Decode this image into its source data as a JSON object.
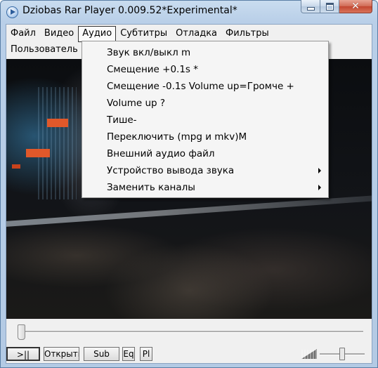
{
  "window": {
    "title": "Dziobas Rar Player 0.009.52*Experimental*",
    "controls": {
      "minimize": "minimize-icon",
      "maximize": "maximize-icon",
      "close": "✕"
    }
  },
  "menubar": {
    "items": [
      "Файл",
      "Видео",
      "Аудио",
      "Субтитры",
      "Отладка",
      "Фильтры"
    ],
    "active": "Аудио",
    "row2": [
      "Пользователь"
    ]
  },
  "audio_menu": {
    "items": [
      {
        "label": "Звук вкл/выкл m",
        "submenu": false
      },
      {
        "label": "Смещение +0.1s *",
        "submenu": false
      },
      {
        "label": "Смещение -0.1s Volume up=Громче +",
        "submenu": false
      },
      {
        "label": "Volume up ?",
        "submenu": false
      },
      {
        "label": "Тише-",
        "submenu": false
      },
      {
        "label": "Переключить (mpg и mkv)M",
        "submenu": false
      },
      {
        "label": "Внешний аудио файл",
        "submenu": false
      },
      {
        "label": "Устройство вывода звука",
        "submenu": true
      },
      {
        "label": "Заменить каналы",
        "submenu": true
      }
    ]
  },
  "seek": {
    "position": 0.0
  },
  "controls": {
    "play_label": ">||",
    "open_label": "Открыть",
    "sub_label": "Sub",
    "eq_label": "Eq",
    "pl_label": "Pl"
  },
  "volume": {
    "level": 0.45
  }
}
